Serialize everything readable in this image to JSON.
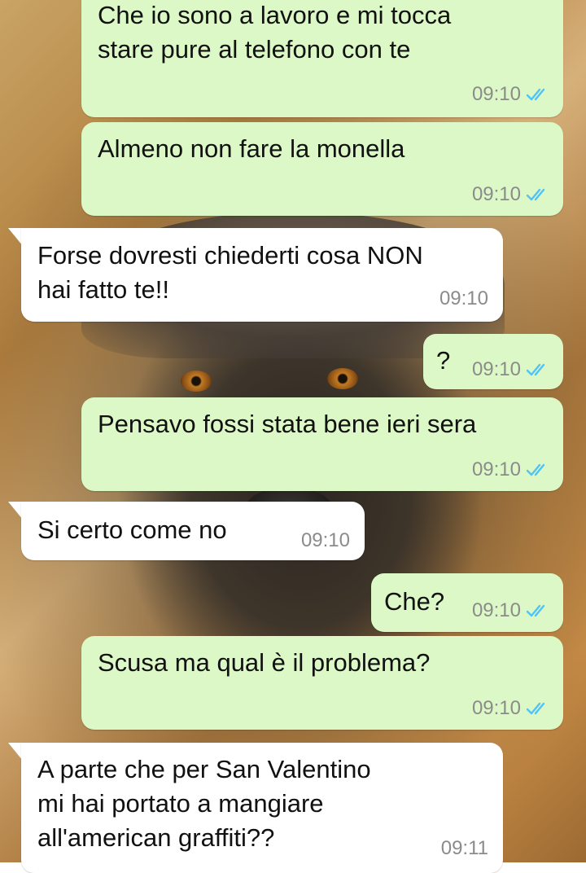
{
  "conversation": {
    "messages": [
      {
        "direction": "out",
        "lines": [
          "Che io sono a lavoro e mi tocca",
          "stare pure al telefono con te"
        ],
        "time": "09:10",
        "status": "read"
      },
      {
        "direction": "out",
        "lines": [
          "Almeno non fare la monella"
        ],
        "time": "09:10",
        "status": "read"
      },
      {
        "direction": "in",
        "lines": [
          "Forse dovresti chiederti cosa NON",
          "hai fatto te!!"
        ],
        "time": "09:10"
      },
      {
        "direction": "out",
        "lines": [
          "?"
        ],
        "time": "09:10",
        "status": "read"
      },
      {
        "direction": "out",
        "lines": [
          "Pensavo fossi stata bene ieri sera"
        ],
        "time": "09:10",
        "status": "read"
      },
      {
        "direction": "in",
        "lines": [
          "Si certo come no"
        ],
        "time": "09:10"
      },
      {
        "direction": "out",
        "lines": [
          "Che?"
        ],
        "time": "09:10",
        "status": "read"
      },
      {
        "direction": "out",
        "lines": [
          "Scusa ma qual è il problema?"
        ],
        "time": "09:10",
        "status": "read"
      },
      {
        "direction": "in",
        "lines": [
          "A parte che per San Valentino",
          "mi hai portato a mangiare",
          "all'american graffiti??"
        ],
        "time": "09:11"
      }
    ]
  },
  "colors": {
    "outgoing_bubble": "#dcf8c6",
    "incoming_bubble": "#ffffff",
    "read_tick": "#4fc3f7",
    "timestamp": "#8b8b8b"
  },
  "icons": {
    "read_receipt": "double-check-icon"
  }
}
